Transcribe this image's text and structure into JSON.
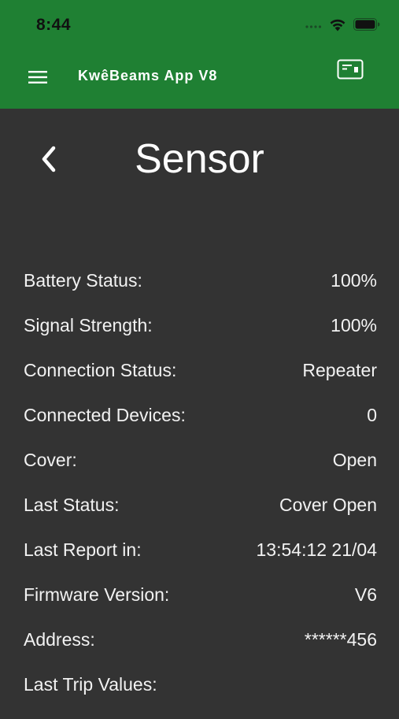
{
  "status_bar": {
    "time": "8:44",
    "icons": [
      "signal-dots-icon",
      "wifi-icon",
      "battery-icon"
    ]
  },
  "header": {
    "title": "KwêBeams App V8",
    "menu_icon": "hamburger-menu-icon",
    "action_icon": "card-icon",
    "background_color": "#1f8033"
  },
  "page": {
    "title": "Sensor",
    "back_icon": "chevron-left-icon",
    "background_color": "#333333"
  },
  "details": [
    {
      "label": "Battery Status:",
      "value": "100%"
    },
    {
      "label": "Signal Strength:",
      "value": "100%"
    },
    {
      "label": "Connection Status:",
      "value": "Repeater"
    },
    {
      "label": "Connected Devices:",
      "value": "0"
    },
    {
      "label": "Cover:",
      "value": "Open"
    },
    {
      "label": "Last Status:",
      "value": "Cover Open"
    },
    {
      "label": "Last Report in:",
      "value": "13:54:12 21/04"
    },
    {
      "label": "Firmware Version:",
      "value": "V6"
    },
    {
      "label": "Address:",
      "value": "******456"
    },
    {
      "label": "Last Trip Values:",
      "value": ""
    }
  ]
}
